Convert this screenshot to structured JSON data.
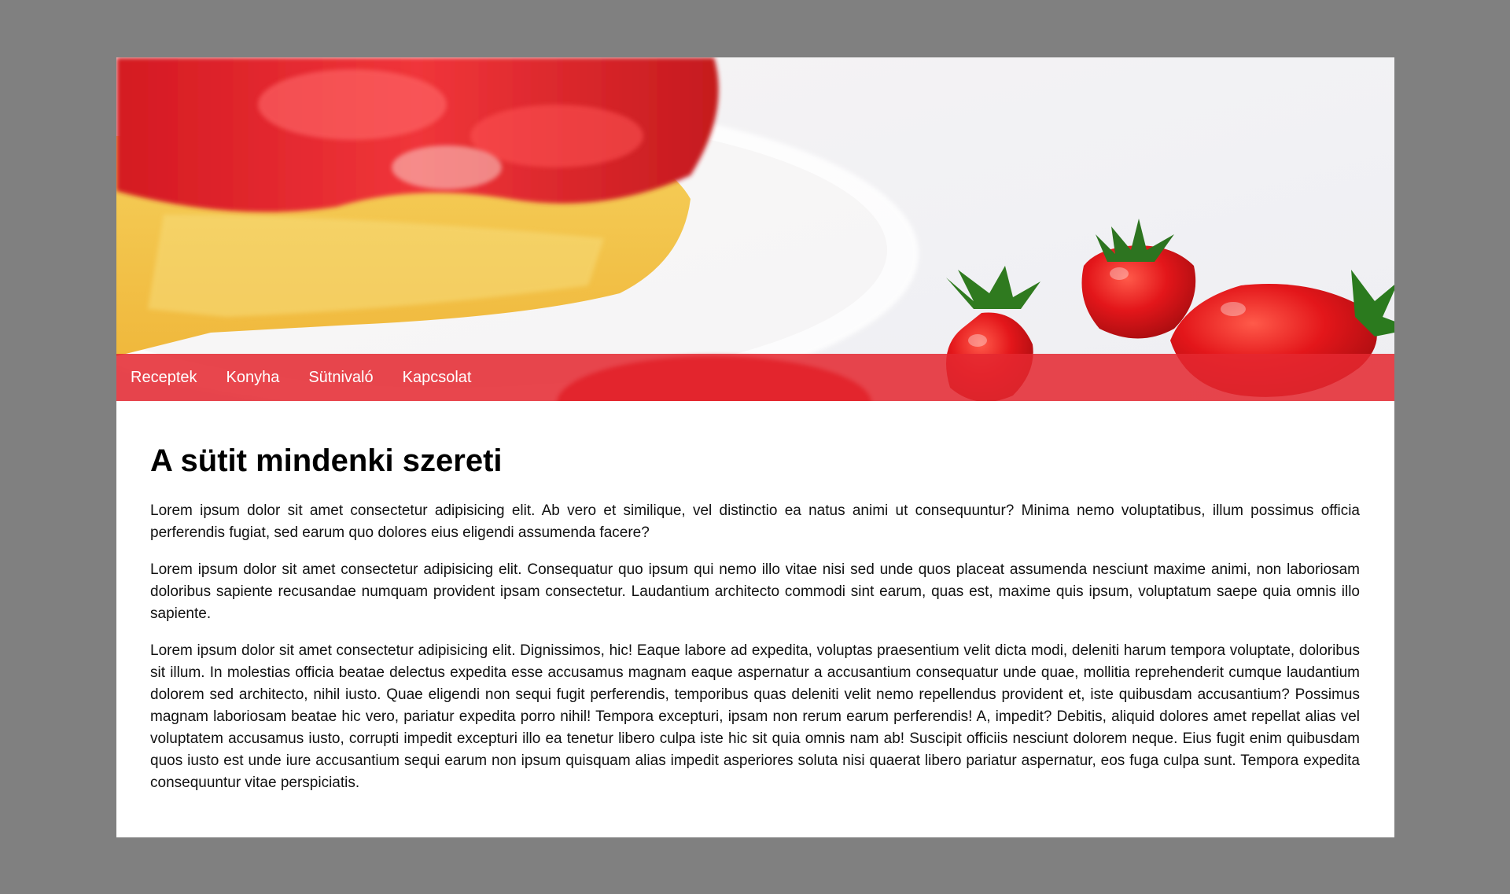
{
  "colors": {
    "backdrop": "#808080",
    "page": "#ffffff",
    "nav_bar": "#e42830",
    "nav_text": "#ffffff",
    "heading": "#000000",
    "body_text": "#111111"
  },
  "hero": {
    "image": "strawberry-cake-photo"
  },
  "nav": {
    "items": [
      {
        "label": "Receptek"
      },
      {
        "label": "Konyha"
      },
      {
        "label": "Sütnivaló"
      },
      {
        "label": "Kapcsolat"
      }
    ]
  },
  "main": {
    "title": "A sütit mindenki szereti",
    "paragraphs": [
      "Lorem ipsum dolor sit amet consectetur adipisicing elit. Ab vero et similique, vel distinctio ea natus animi ut consequuntur? Minima nemo voluptatibus, illum possimus officia perferendis fugiat, sed earum quo dolores eius eligendi assumenda facere?",
      "Lorem ipsum dolor sit amet consectetur adipisicing elit. Consequatur quo ipsum qui nemo illo vitae nisi sed unde quos placeat assumenda nesciunt maxime animi, non laboriosam doloribus sapiente recusandae numquam provident ipsam consectetur. Laudantium architecto commodi sint earum, quas est, maxime quis ipsum, voluptatum saepe quia omnis illo sapiente.",
      "Lorem ipsum dolor sit amet consectetur adipisicing elit. Dignissimos, hic! Eaque labore ad expedita, voluptas praesentium velit dicta modi, deleniti harum tempora voluptate, doloribus sit illum. In molestias officia beatae delectus expedita esse accusamus magnam eaque aspernatur a accusantium consequatur unde quae, mollitia reprehenderit cumque laudantium dolorem sed architecto, nihil iusto. Quae eligendi non sequi fugit perferendis, temporibus quas deleniti velit nemo repellendus provident et, iste quibusdam accusantium? Possimus magnam laboriosam beatae hic vero, pariatur expedita porro nihil! Tempora excepturi, ipsam non rerum earum perferendis! A, impedit? Debitis, aliquid dolores amet repellat alias vel voluptatem accusamus iusto, corrupti impedit excepturi illo ea tenetur libero culpa iste hic sit quia omnis nam ab! Suscipit officiis nesciunt dolorem neque. Eius fugit enim quibusdam quos iusto est unde iure accusantium sequi earum non ipsum quisquam alias impedit asperiores soluta nisi quaerat libero pariatur aspernatur, eos fuga culpa sunt. Tempora expedita consequuntur vitae perspiciatis."
    ]
  }
}
